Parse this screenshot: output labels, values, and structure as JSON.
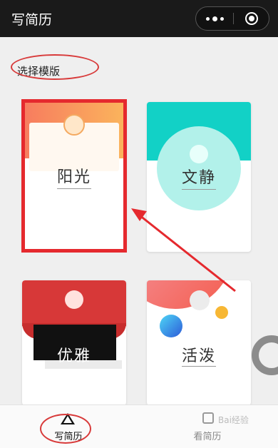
{
  "header": {
    "title": "写简历",
    "more_icon": "more-dots-icon",
    "close_icon": "target-close-icon"
  },
  "section": {
    "label": "选择模版"
  },
  "templates": [
    {
      "name": "阳光",
      "selected": true,
      "accent": "#fbb55c"
    },
    {
      "name": "文静",
      "selected": false,
      "accent": "#12d1c6"
    },
    {
      "name": "优雅",
      "selected": false,
      "accent": "#d73838"
    },
    {
      "name": "活泼",
      "selected": false,
      "accent": "#f35c4d"
    }
  ],
  "annotation": {
    "color": "#e5292e"
  },
  "tabbar": {
    "tabs": [
      {
        "label": "写简历",
        "icon": "triangle-icon",
        "active": true
      },
      {
        "label": "看简历",
        "icon": "document-icon",
        "active": false
      }
    ]
  },
  "watermark": {
    "text": "Bai经验"
  }
}
